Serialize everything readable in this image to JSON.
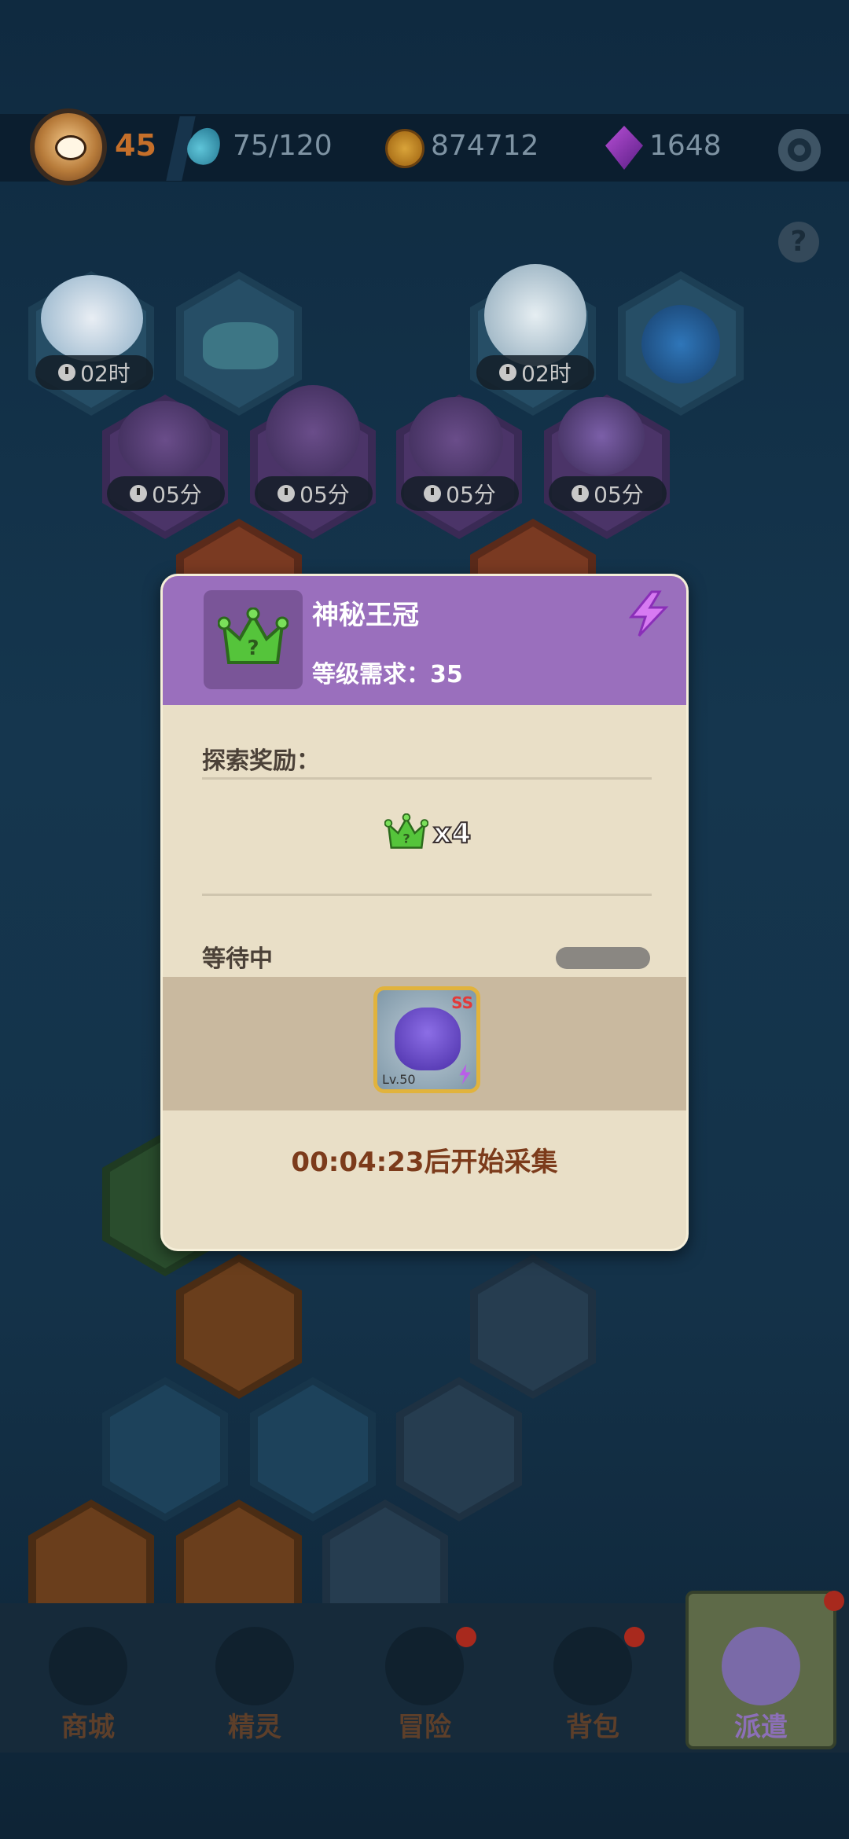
{
  "top_bar": {
    "player_level": "45",
    "energy": "75/120",
    "coins": "874712",
    "gems": "1648"
  },
  "map": {
    "timers": [
      "02时",
      "02时",
      "05分",
      "05分",
      "05分",
      "05分"
    ]
  },
  "dialog": {
    "title": "神秘王冠",
    "level_requirement": "等级需求：35",
    "reward_label": "探索奖励：",
    "reward_count": "x4",
    "status_label": "等待中",
    "progress": 0,
    "monster_level": "Lv.50",
    "monster_rank": "SS",
    "countdown": "00:04:23后开始采集"
  },
  "bottom_nav": {
    "items": [
      {
        "label": "商城"
      },
      {
        "label": "精灵"
      },
      {
        "label": "冒险"
      },
      {
        "label": "背包"
      },
      {
        "label": "派遣"
      }
    ]
  }
}
